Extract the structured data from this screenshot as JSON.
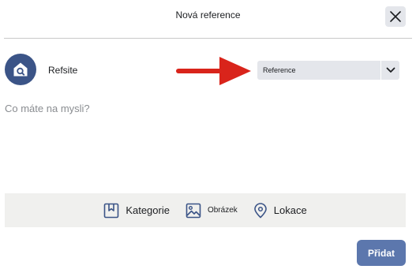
{
  "dialog": {
    "title": "Nová reference",
    "close_icon": "close-icon"
  },
  "author": {
    "name": "Refsite",
    "avatar_icon": "refsite-logo-icon"
  },
  "post_type": {
    "selected": "Reference",
    "caret_icon": "chevron-down-icon"
  },
  "composer": {
    "value": "",
    "placeholder": "Co máte na mysli?"
  },
  "toolbar": {
    "items": [
      {
        "label": "Kategorie",
        "icon": "bookmark-icon"
      },
      {
        "label": "Obrázek",
        "icon": "image-icon"
      },
      {
        "label": "Lokace",
        "icon": "location-pin-icon"
      }
    ]
  },
  "submit": {
    "label": "Přidat"
  },
  "colors": {
    "accent": "#5c77ad",
    "avatar": "#3b5487",
    "arrow": "#d9241b",
    "icon": "#3b5487"
  }
}
